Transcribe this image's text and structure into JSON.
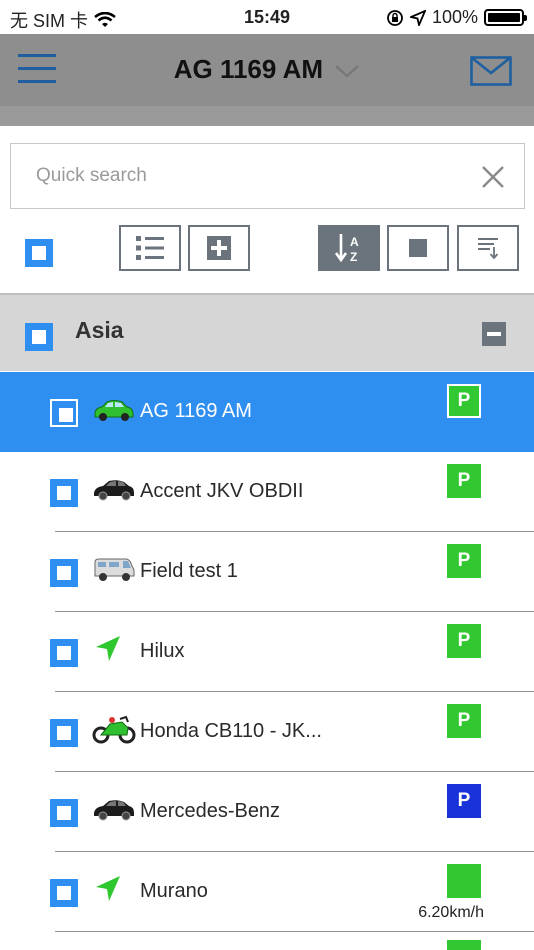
{
  "status_bar": {
    "carrier": "无 SIM 卡",
    "time": "15:49",
    "battery": "100%",
    "wifi_icon": "wifi-icon",
    "lock_icon": "orientation-lock-icon",
    "location_icon": "location-arrow-icon"
  },
  "nav": {
    "title": "AG 1169 AM",
    "menu_icon": "hamburger-menu-icon",
    "mail_icon": "envelope-icon"
  },
  "search": {
    "placeholder": "Quick search",
    "value": ""
  },
  "toolbar": {
    "buttons": [
      "list-icon",
      "add-icon",
      "sort-az-icon",
      "stop-icon",
      "filter-icon"
    ]
  },
  "group": {
    "name": "Asia"
  },
  "vehicles": [
    {
      "name": "AG 1169 AM",
      "icon": "green-car-icon",
      "badge": "P",
      "badge_color": "#32c832",
      "selected": true
    },
    {
      "name": "Accent JKV OBDII",
      "icon": "black-car-icon",
      "badge": "P",
      "badge_color": "#32c832"
    },
    {
      "name": "Field test 1",
      "icon": "van-icon",
      "badge": "P",
      "badge_color": "#32c832"
    },
    {
      "name": "Hilux",
      "icon": "green-arrow-icon",
      "badge": "P",
      "badge_color": "#32c832"
    },
    {
      "name": "Honda CB110 - JK...",
      "icon": "motorcycle-icon",
      "badge": "P",
      "badge_color": "#32c832"
    },
    {
      "name": "Mercedes-Benz",
      "icon": "black-car-icon",
      "badge": "P",
      "badge_color": "#1a33d8"
    },
    {
      "name": "Murano",
      "icon": "green-arrow-icon",
      "badge": "",
      "badge_color": "#32c832",
      "speed": "6.20km/h"
    }
  ]
}
